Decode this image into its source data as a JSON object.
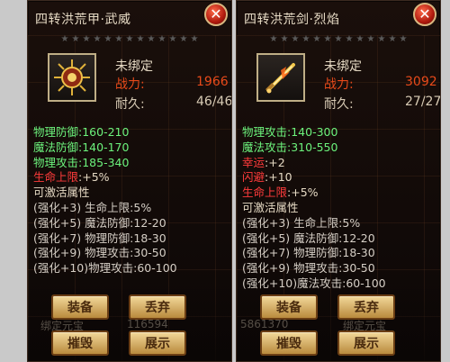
{
  "panels": [
    {
      "title": "四转洪荒甲·武威",
      "close": "✕",
      "unbound": "未绑定",
      "power_label": "战力:",
      "power_value": "1966",
      "durability_label": "耐久:",
      "durability_value": "46/46",
      "base_stats": [
        {
          "text": "物理防御:160-210",
          "color": "green"
        },
        {
          "text": "魔法防御:140-170",
          "color": "green"
        },
        {
          "text": "物理攻击:185-340",
          "color": "green"
        }
      ],
      "hp_label": "生命上限",
      "hp_value": ":+5%",
      "activatable_title": "可激活属性",
      "enhance_lines": [
        "(强化+3) 生命上限:5%",
        "(强化+5) 魔法防御:12-20",
        "(强化+7) 物理防御:18-30",
        "(强化+9) 物理攻击:30-50",
        "(强化+10)物理攻击:60-100"
      ],
      "buttons": {
        "equip": "装备",
        "discard": "丢弃",
        "destroy": "摧毁",
        "show": "展示"
      },
      "bg_text": {
        "a": "绑定元宝",
        "b": "116594"
      }
    },
    {
      "title": "四转洪荒剑·烈焰",
      "close": "✕",
      "unbound": "未绑定",
      "power_label": "战力:",
      "power_value": "3092",
      "durability_label": "耐久:",
      "durability_value": "27/27",
      "base_stats": [
        {
          "text": "物理攻击:140-300",
          "color": "green"
        },
        {
          "text": "魔法攻击:310-550",
          "color": "green"
        }
      ],
      "extra_stats": [
        {
          "label": "幸运",
          "value": ":+2"
        },
        {
          "label": "闪避",
          "value": ":+10"
        },
        {
          "label": "生命上限",
          "value": ":+5%"
        }
      ],
      "activatable_title": "可激活属性",
      "enhance_lines": [
        "(强化+3) 生命上限:5%",
        "(强化+5) 魔法防御:12-20",
        "(强化+7) 物理防御:18-30",
        "(强化+9) 物理攻击:30-50",
        "(强化+10)魔法攻击:60-100"
      ],
      "buttons": {
        "equip": "装备",
        "discard": "丢弃",
        "destroy": "摧毁",
        "show": "展示"
      },
      "bg_text": {
        "a": "5861370",
        "b": "绑定元宝"
      }
    }
  ],
  "colors": {
    "power": "#e84a1a",
    "green": "#6cf27c",
    "red": "#ff3b3b",
    "button": "#d9b16a"
  },
  "icons": {
    "left_item": "spiked-armor-icon",
    "right_item": "flame-sword-icon"
  }
}
